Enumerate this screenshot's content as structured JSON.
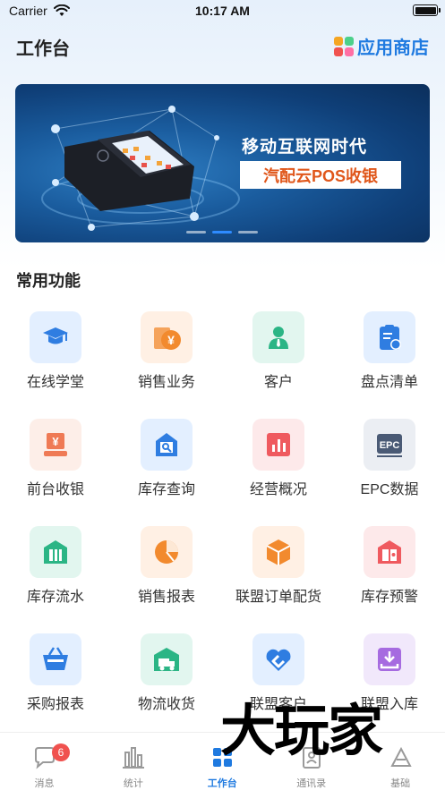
{
  "status_bar": {
    "carrier": "Carrier",
    "time": "10:17 AM"
  },
  "header": {
    "title": "工作台",
    "store_label": "应用商店"
  },
  "banner": {
    "headline": "移动互联网时代",
    "sub": "汽配云POS收银",
    "active_slide": 2,
    "slide_count": 3
  },
  "section": {
    "title": "常用功能"
  },
  "functions": [
    {
      "label": "在线学堂",
      "icon": "graduation-cap-icon",
      "tile_bg": "#e3efff",
      "icon_color": "#2f7de1"
    },
    {
      "label": "销售业务",
      "icon": "yen-bill-icon",
      "tile_bg": "#fff0e4",
      "icon_color": "#f28a2e"
    },
    {
      "label": "客户",
      "icon": "person-icon",
      "tile_bg": "#e2f6ef",
      "icon_color": "#2bb585"
    },
    {
      "label": "盘点清单",
      "icon": "inventory-list-icon",
      "tile_bg": "#e3efff",
      "icon_color": "#2f7de1"
    },
    {
      "label": "前台收银",
      "icon": "cash-register-icon",
      "tile_bg": "#fdeee8",
      "icon_color": "#ef7a55"
    },
    {
      "label": "库存查询",
      "icon": "stock-search-icon",
      "tile_bg": "#e3efff",
      "icon_color": "#2f7de1"
    },
    {
      "label": "经营概况",
      "icon": "bar-chart-icon",
      "tile_bg": "#fde9ea",
      "icon_color": "#ef5a5f"
    },
    {
      "label": "EPC数据",
      "icon": "epc-icon",
      "tile_bg": "#ebeef3",
      "icon_color": "#4a5a75"
    },
    {
      "label": "库存流水",
      "icon": "warehouse-flow-icon",
      "tile_bg": "#e2f6ef",
      "icon_color": "#2bb585"
    },
    {
      "label": "销售报表",
      "icon": "pie-chart-icon",
      "tile_bg": "#fff0e4",
      "icon_color": "#f28a2e"
    },
    {
      "label": "联盟订单配货",
      "icon": "package-icon",
      "tile_bg": "#fff0e4",
      "icon_color": "#f28a2e"
    },
    {
      "label": "库存预警",
      "icon": "stock-alert-icon",
      "tile_bg": "#fde9ea",
      "icon_color": "#ef5a5f"
    },
    {
      "label": "采购报表",
      "icon": "basket-icon",
      "tile_bg": "#e3efff",
      "icon_color": "#2f7de1"
    },
    {
      "label": "物流收货",
      "icon": "delivery-truck-icon",
      "tile_bg": "#e2f6ef",
      "icon_color": "#2bb585"
    },
    {
      "label": "联盟客户",
      "icon": "alliance-icon",
      "tile_bg": "#e3efff",
      "icon_color": "#2f7de1"
    },
    {
      "label": "联盟入库",
      "icon": "inbound-tray-icon",
      "tile_bg": "#f1e8fb",
      "icon_color": "#a66be0"
    }
  ],
  "tabs": [
    {
      "label": "消息",
      "icon": "message-bubble-icon",
      "badge": "6",
      "active": false
    },
    {
      "label": "统计",
      "icon": "statistics-icon",
      "active": false
    },
    {
      "label": "工作台",
      "icon": "workbench-grid-icon",
      "active": true
    },
    {
      "label": "通讯录",
      "icon": "contacts-icon",
      "active": false
    },
    {
      "label": "基础",
      "icon": "base-icon",
      "active": false
    }
  ],
  "watermark": "大玩家",
  "colors": {
    "accent": "#1f7ae0",
    "badge": "#f0524f",
    "banner_sub_text": "#e0571b"
  }
}
